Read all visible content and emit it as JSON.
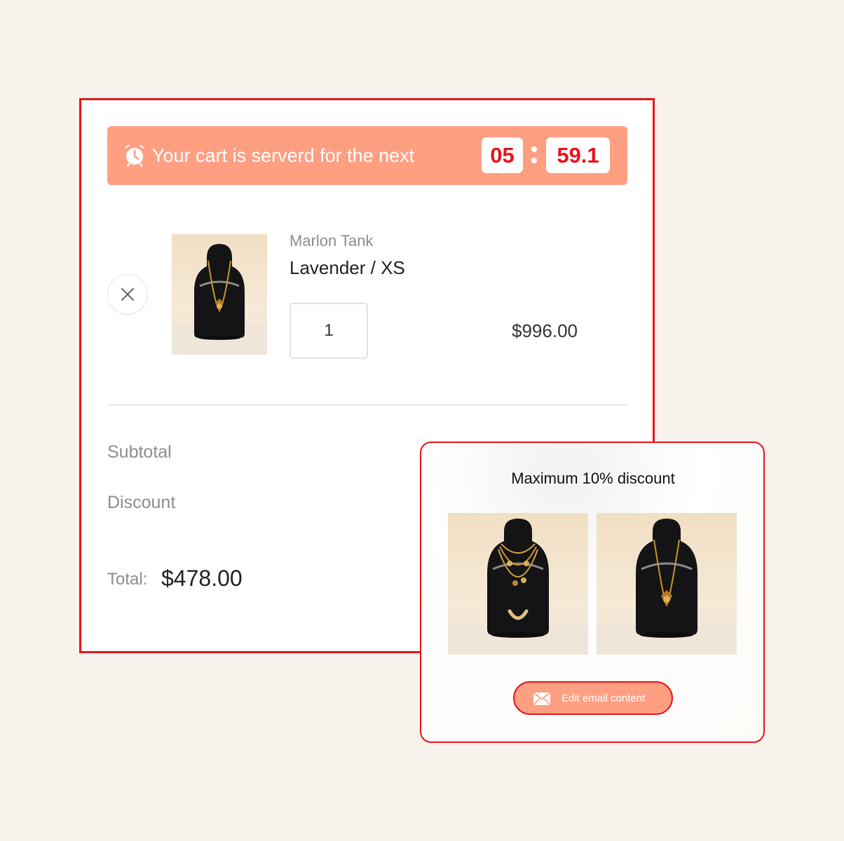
{
  "timer": {
    "message": "Your cart is serverd for the next",
    "minutes": "05",
    "seconds": "59.1",
    "icon": "alarm-clock-icon"
  },
  "cart_item": {
    "product_name": "Marlon Tank",
    "variant": "Lavender / XS",
    "quantity": "1",
    "price": "$996.00",
    "image": "necklace-on-bust"
  },
  "summary": {
    "subtotal_label": "Subtotal",
    "discount_label": "Discount",
    "total_label": "Total:",
    "total_value": "$478.00"
  },
  "email_preview": {
    "title": "Maximum 10% discount",
    "images": [
      "layered-necklaces-on-bust",
      "heart-pendant-necklace-on-bust"
    ],
    "button_label": "Edit email content",
    "button_icon": "mail-icon"
  },
  "colors": {
    "accent_red": "#e8121b",
    "timer_bar": "#ff9f82",
    "page_background": "#f7f2eb"
  }
}
